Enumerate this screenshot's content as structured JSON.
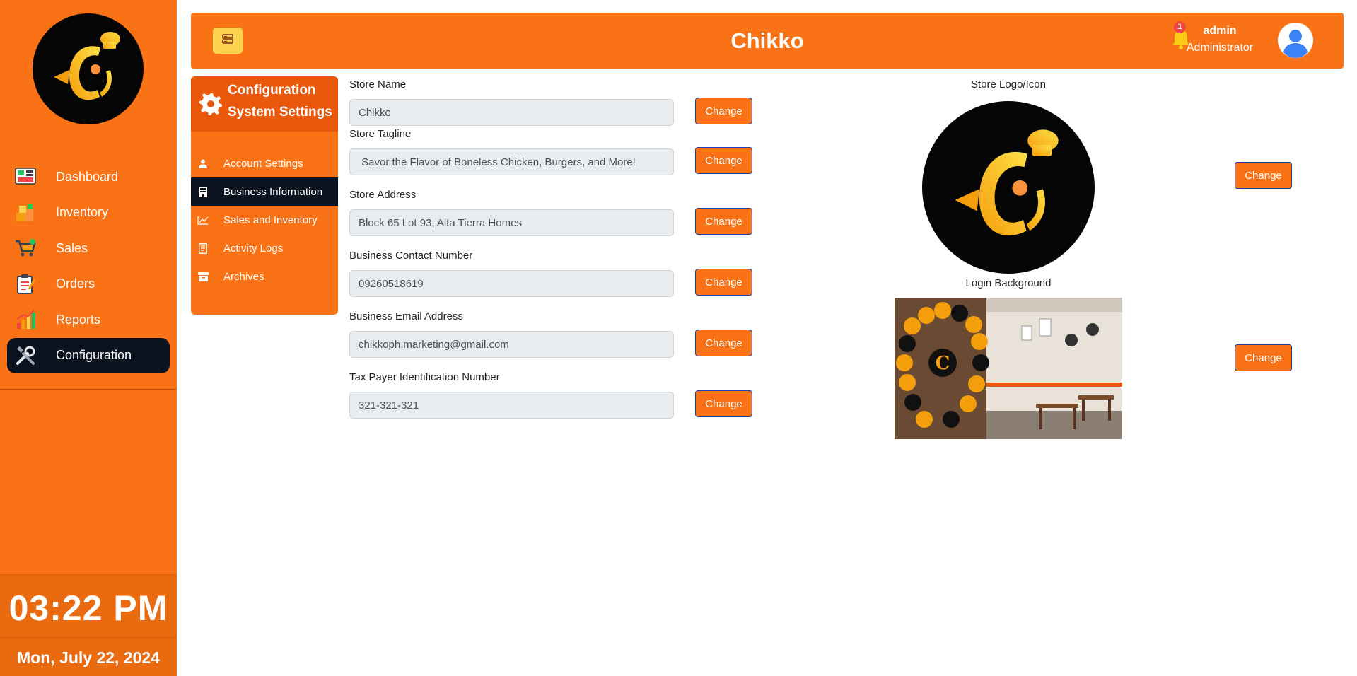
{
  "sidebar": {
    "items": [
      {
        "label": "Dashboard",
        "icon": "dashboard-icon"
      },
      {
        "label": "Inventory",
        "icon": "inventory-icon"
      },
      {
        "label": "Sales",
        "icon": "sales-cart-icon"
      },
      {
        "label": "Orders",
        "icon": "orders-icon"
      },
      {
        "label": "Reports",
        "icon": "reports-chart-icon"
      },
      {
        "label": "Configuration",
        "icon": "configuration-tools-icon"
      }
    ],
    "active": "Configuration",
    "clock": {
      "time": "03:22 PM",
      "date": "Mon, July 22, 2024"
    }
  },
  "header": {
    "title": "Chikko",
    "notification_count": "1",
    "user_name": "admin",
    "user_role": "Administrator"
  },
  "config_panel": {
    "title_line1": "Configuration",
    "title_line2": "System Settings",
    "items": [
      {
        "label": "Account Settings",
        "icon": "user-icon"
      },
      {
        "label": "Business Information",
        "icon": "building-icon"
      },
      {
        "label": "Sales and Inventory",
        "icon": "line-chart-icon"
      },
      {
        "label": "Activity Logs",
        "icon": "log-icon"
      },
      {
        "label": "Archives",
        "icon": "archive-icon"
      }
    ],
    "active": "Business Information"
  },
  "form": {
    "change_label": "Change",
    "fields": [
      {
        "label": "Store Name",
        "value": "Chikko"
      },
      {
        "label": "Store Tagline",
        "value": " Savor the Flavor of Boneless Chicken, Burgers, and More!"
      },
      {
        "label": "Store Address",
        "value": "Block 65 Lot 93, Alta Tierra Homes"
      },
      {
        "label": "Business Contact Number",
        "value": "09260518619"
      },
      {
        "label": "Business Email Address",
        "value": "chikkoph.marketing@gmail.com"
      },
      {
        "label": "Tax Payer Identification Number",
        "value": "321-321-321"
      }
    ]
  },
  "images": {
    "logo_label": "Store Logo/Icon",
    "background_label": "Login Background"
  },
  "colors": {
    "brand_orange": "#f97316",
    "active_dark": "#0b1220",
    "accent_yellow": "#fcd34d"
  }
}
